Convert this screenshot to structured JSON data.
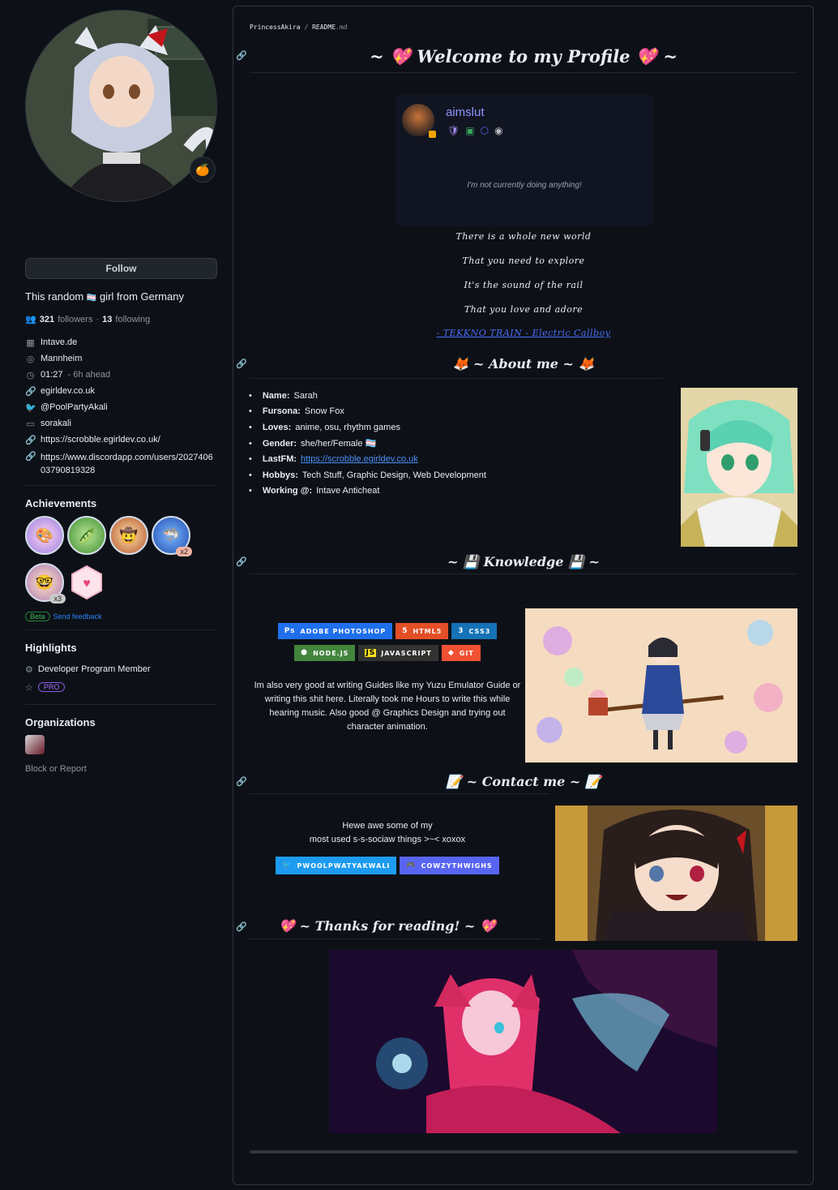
{
  "sidebar": {
    "status_emoji": "🍊",
    "follow_label": "Follow",
    "bio_before": "This random",
    "bio_flag": "🏳️‍⚧️",
    "bio_after": "girl from Germany",
    "followers_count": "321",
    "followers_label": "followers",
    "following_count": "13",
    "following_label": "following",
    "company": "Intave.de",
    "location": "Mannheim",
    "time": "01:27",
    "time_offset": "- 6h ahead",
    "website": "egirldev.co.uk",
    "twitter": "@PoolPartyAkali",
    "twitch": "sorakali",
    "link1": "https://scrobble.egirldev.co.uk/",
    "link2": "https://www.discordapp.com/users/202740603790819328",
    "achievements_title": "Achievements",
    "achievements": [
      {
        "name": "YOLO",
        "count": ""
      },
      {
        "name": "Pair Extraordinaire",
        "count": ""
      },
      {
        "name": "Quickdraw",
        "count": ""
      },
      {
        "name": "Pull Shark",
        "count": "x2"
      },
      {
        "name": "Galaxy Brain",
        "count": "x3"
      },
      {
        "name": "Heart On Your Sleeve",
        "count": ""
      }
    ],
    "beta_label": "Beta",
    "feedback_label": "Send feedback",
    "highlights_title": "Highlights",
    "highlight_dev": "Developer Program Member",
    "highlight_pro": "PRO",
    "orgs_title": "Organizations",
    "block_label": "Block or Report"
  },
  "readme": {
    "crumb_user": "PrincessAkira",
    "crumb_sep": "/",
    "crumb_file": "README",
    "crumb_ext": ".md",
    "welcome_heading": "~ 💖 Welcome to my Profile 💖 ~",
    "discord_card": {
      "username": "aimslut",
      "status": "I'm not currently doing anything!"
    },
    "lyrics": [
      "There is a whole new world",
      "That you need to explore",
      "It's the sound of the rail",
      "That you love and adore"
    ],
    "song_link": "- TEKKNO TRAIN - Electric Callboy",
    "about_heading": "🦊 ~ About me ~ 🦊",
    "about": [
      {
        "label": "Name:",
        "value": "Sarah"
      },
      {
        "label": "Fursona:",
        "value": "Snow Fox"
      },
      {
        "label": "Loves:",
        "value": "anime, osu, rhythm games"
      },
      {
        "label": "Gender:",
        "value": "she/her/Female 🏳️‍⚧️"
      },
      {
        "label": "LastFM:",
        "value": "https://scrobble.egirldev.co.uk"
      },
      {
        "label": "Hobbys:",
        "value": "Tech Stuff, Graphic Design, Web Development"
      },
      {
        "label": "Working @:",
        "value": "Intave Anticheat"
      }
    ],
    "knowledge_heading": "~ 💾 Knowledge 💾 ~",
    "badges_row1": [
      {
        "label": "ADOBE PHOTOSHOP",
        "icon": "Ps",
        "color": "#1f6feb"
      },
      {
        "label": "HTML5",
        "icon": "5",
        "color": "#e34f26"
      },
      {
        "label": "CSS3",
        "icon": "3",
        "color": "#1572b6"
      }
    ],
    "badges_row2": [
      {
        "label": "NODE.JS",
        "icon": "⬢",
        "color": "#43853d"
      },
      {
        "label": "JAVASCRIPT",
        "icon": "JS",
        "color": "#323330"
      },
      {
        "label": "GIT",
        "icon": "◆",
        "color": "#f05033"
      }
    ],
    "knowledge_text": "Im also very good at writing Guides like my Yuzu Emulator Guide or writing this shit here. Literally took me Hours to write this while hearing music. Also good @ Graphics Design and trying out character animation.",
    "contact_heading": "📝 ~ Contact me ~ 📝",
    "contact_text_1": "Hewe awe some of my",
    "contact_text_2": "most used s-s-sociaw things >~< xoxox",
    "contact_badges": [
      {
        "label": "PWOOLPWATYAKWALI",
        "icon": "🐦",
        "color": "#1d9bf0"
      },
      {
        "label": "COWZYTHWIGHS",
        "icon": "🎮",
        "color": "#5865f2"
      }
    ],
    "thanks_heading": "💖 ~ Thanks for reading! ~ 💖"
  }
}
